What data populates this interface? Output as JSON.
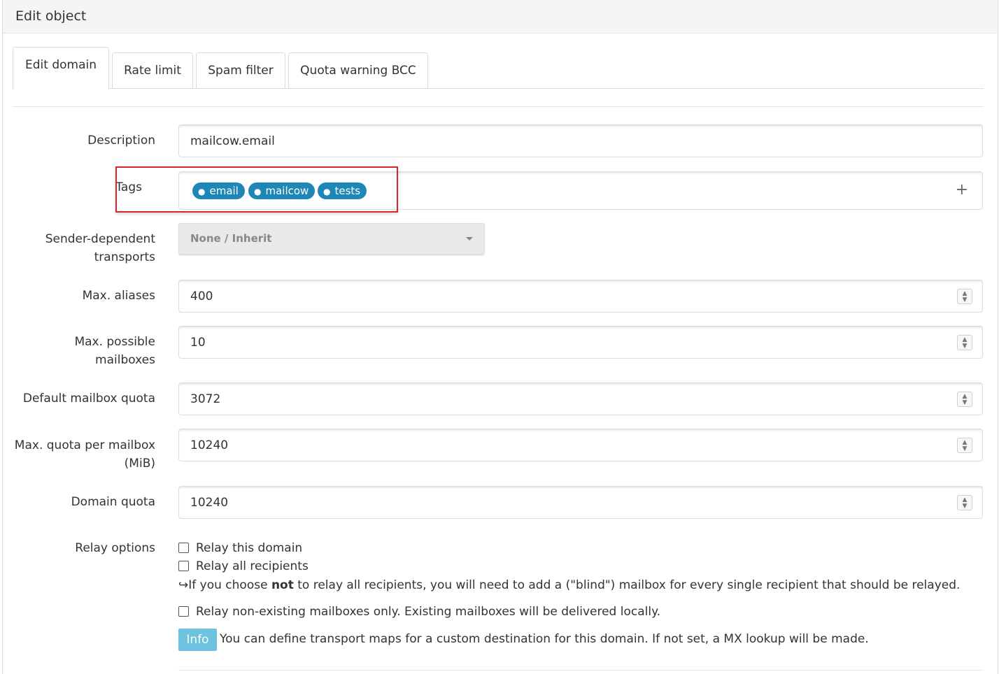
{
  "panel": {
    "title": "Edit object"
  },
  "tabs": [
    {
      "label": "Edit domain"
    },
    {
      "label": "Rate limit"
    },
    {
      "label": "Spam filter"
    },
    {
      "label": "Quota warning BCC"
    }
  ],
  "form": {
    "description": {
      "label": "Description",
      "value": "mailcow.email"
    },
    "tags": {
      "label": "Tags",
      "items": [
        "email",
        "mailcow",
        "tests"
      ],
      "add_symbol": "+"
    },
    "sender_transports": {
      "label_line1": "Sender-dependent",
      "label_line2": "transports",
      "selected": "None / Inherit"
    },
    "max_aliases": {
      "label": "Max. aliases",
      "value": "400"
    },
    "max_mailboxes": {
      "label_line1": "Max. possible",
      "label_line2": "mailboxes",
      "value": "10"
    },
    "default_quota": {
      "label": "Default mailbox quota",
      "value": "3072"
    },
    "max_quota": {
      "label_line1": "Max. quota per mailbox",
      "label_line2": "(MiB)",
      "value": "10240"
    },
    "domain_quota": {
      "label": "Domain quota",
      "value": "10240"
    },
    "relay": {
      "label": "Relay options",
      "relay_domain": "Relay this domain",
      "relay_all": "Relay all recipients",
      "note_arrow": "↪",
      "note_pre": "If you choose ",
      "note_bold": "not",
      "note_post": " to relay all recipients, you will need to add a (\"blind\") mailbox for every single recipient that should be relayed.",
      "relay_nonexisting": "Relay non-existing mailboxes only. Existing mailboxes will be delivered locally.",
      "info_badge": "Info",
      "info_text": "You can define transport maps for a custom destination for this domain. If not set, a MX lookup will be made."
    }
  },
  "colors": {
    "tag_bg": "#1e87b7",
    "info_bg": "#6cc3e0",
    "highlight": "#d9262c"
  }
}
